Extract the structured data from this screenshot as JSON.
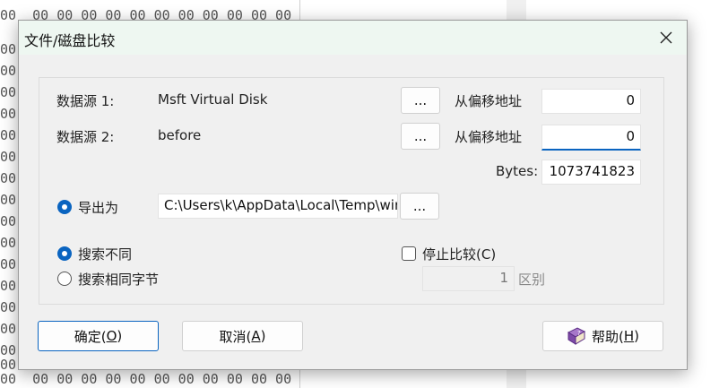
{
  "background": {
    "hex_rows": [
      "00  00 00 00 00 00 00 00 00 00 00 00",
      "00",
      "00",
      "00",
      "00",
      "00",
      "00",
      "00",
      "00",
      "00",
      "00",
      "00",
      "00",
      "00",
      "00",
      "00",
      "00",
      "00  00 00 00 00 00 00 00 00 00 00 00"
    ]
  },
  "dialog": {
    "title": "文件/磁盘比较",
    "source1_label": "数据源 1:",
    "source1_value": "Msft Virtual Disk",
    "source2_label": "数据源 2:",
    "source2_value": "before",
    "browse_label": "...",
    "offset_label": "从偏移地址",
    "offset1_value": "0",
    "offset2_value": "0",
    "bytes_label": "Bytes:",
    "bytes_value": "1073741823",
    "export_label": "导出为",
    "export_path": "C:\\Users\\k\\AppData\\Local\\Temp\\winh",
    "search_diff_label": "搜索不同",
    "search_same_label": "搜索相同字节",
    "stop_compare_label": "停止比较(C)",
    "diff_count_value": "1",
    "diff_unit_label": "区别",
    "ok_text": "确定(",
    "ok_key": "O",
    "ok_close": ")",
    "cancel_text": "取消(",
    "cancel_key": "A",
    "cancel_close": ")",
    "help_text": "帮助(",
    "help_key": "H",
    "help_close": ")"
  },
  "colors": {
    "accent": "#0a64c0",
    "titlebar": "#eef7f1",
    "dialog_bg": "#f0f0f0"
  },
  "icons": {
    "close": "close-icon",
    "help": "help-book-icon"
  }
}
